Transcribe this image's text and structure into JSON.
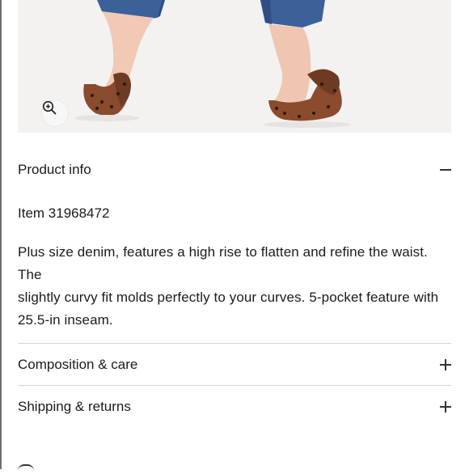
{
  "product_image": {
    "alt": "Model wearing denim jeans with leopard print flats",
    "zoom_icon": "zoom-in-icon"
  },
  "product_info": {
    "label": "Product info",
    "state_icon": "minus-icon",
    "item_number": "Item 31968472",
    "description_lines": [
      "Plus size denim, features a high rise to flatten and refine the waist. The",
      "slightly curvy fit molds perfectly to your curves. 5-pocket feature with",
      "25.5-in inseam."
    ]
  },
  "composition_care": {
    "label": "Composition & care",
    "state_icon": "plus-icon"
  },
  "shipping_returns": {
    "label": "Shipping & returns",
    "state_icon": "plus-icon"
  },
  "colors": {
    "text": "#1b1b1b",
    "divider": "#d4d4d4",
    "photo_bg": "#f3f2f1",
    "denim": "#3a5f95"
  }
}
